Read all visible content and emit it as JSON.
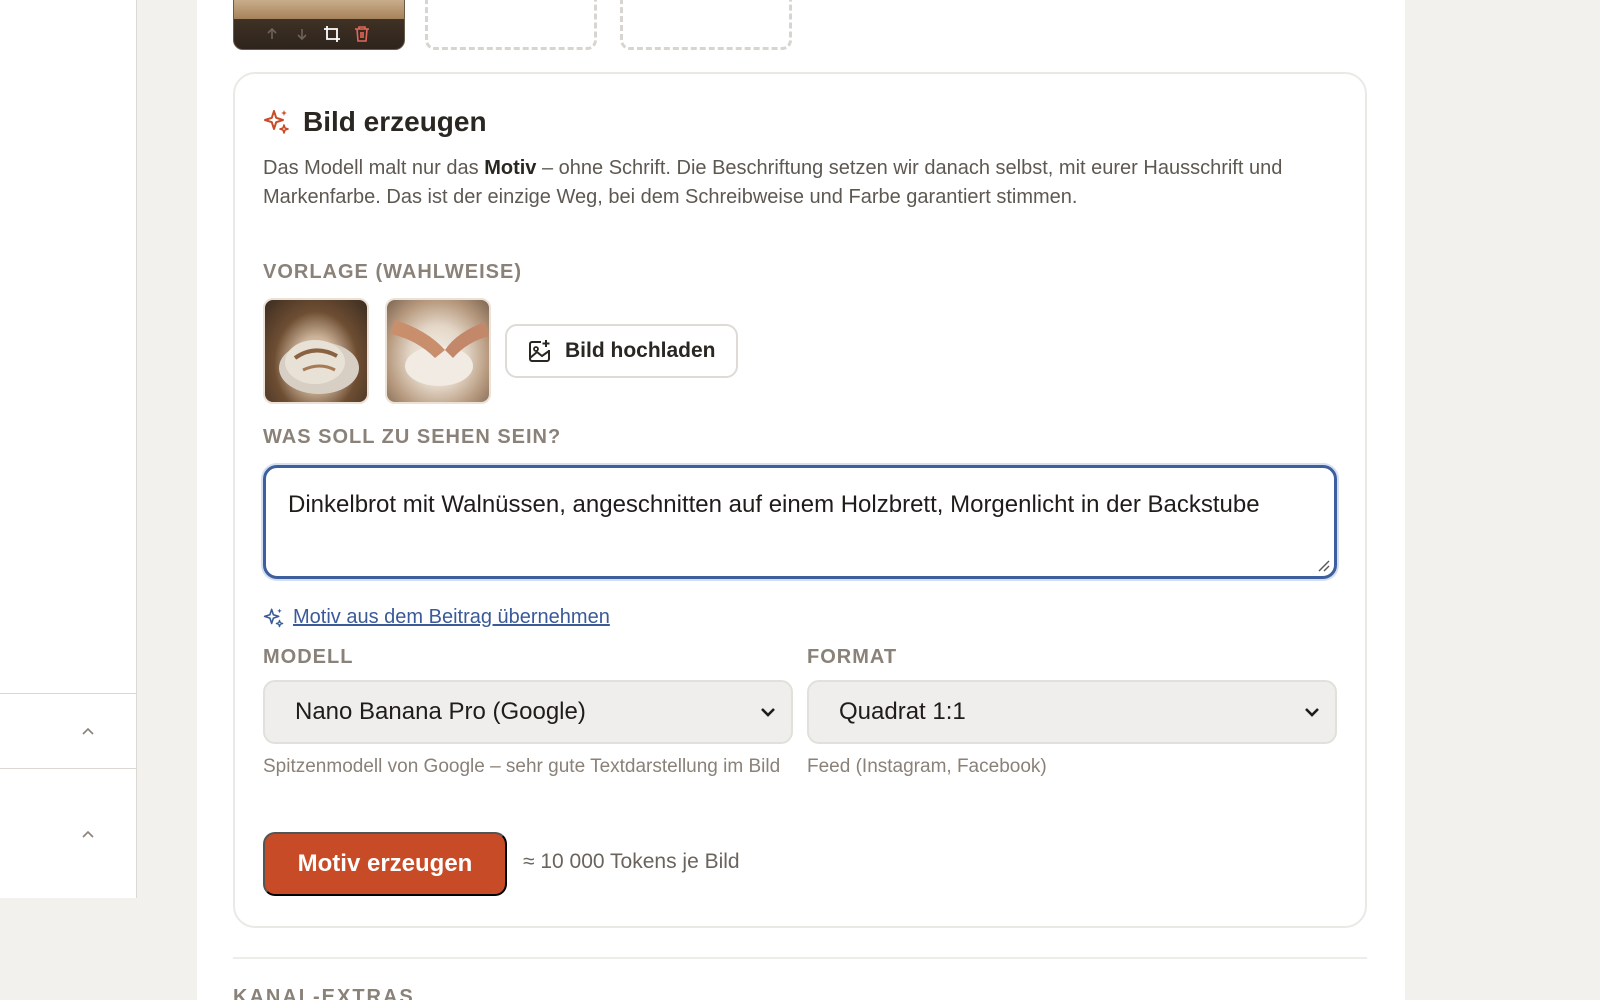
{
  "card": {
    "title": "Bild erzeugen",
    "desc_before": "Das Modell malt nur das ",
    "desc_bold": "Motiv",
    "desc_after": " – ohne Schrift. Die Beschriftung setzen wir danach selbst, mit eurer Hausschrift und Markenfarbe. Das ist der einzige Weg, bei dem Schreibweise und Farbe garantiert stimmen.",
    "reference_label": "VORLAGE (WAHLWEISE)",
    "upload_label": "Bild hochladen",
    "prompt_label": "WAS SOLL ZU SEHEN SEIN?",
    "prompt_value": "Dinkelbrot mit Walnüssen, angeschnitten auf einem Holzbrett, Morgenlicht in der Backstube",
    "motif_link": "Motiv aus dem Beitrag übernehmen",
    "model_label": "MODELL",
    "model_value": "Nano Banana Pro (Google)",
    "model_hint": "Spitzenmodell von Google – sehr gute Textdarstellung im Bild",
    "format_label": "FORMAT",
    "format_value": "Quadrat 1:1",
    "format_hint": "Feed (Instagram, Facebook)",
    "generate_button": "Motiv erzeugen",
    "cost": "≈ 10 000 Tokens je Bild"
  },
  "next_section": {
    "title": "KANAL-EXTRAS"
  },
  "icons": {
    "sparkle": "sparkle-icon",
    "image_upload": "image-plus-icon",
    "crop": "crop-icon",
    "trash": "trash-icon",
    "arrow_up": "arrow-up-icon",
    "arrow_down": "arrow-down-icon",
    "chevron_up": "chevron-up-icon",
    "chevron_down": "chevron-down-icon"
  },
  "colors": {
    "accent": "#c84b27",
    "link": "#3a5a98",
    "focus": "#3e5f9e",
    "muted": "#8a8178"
  }
}
